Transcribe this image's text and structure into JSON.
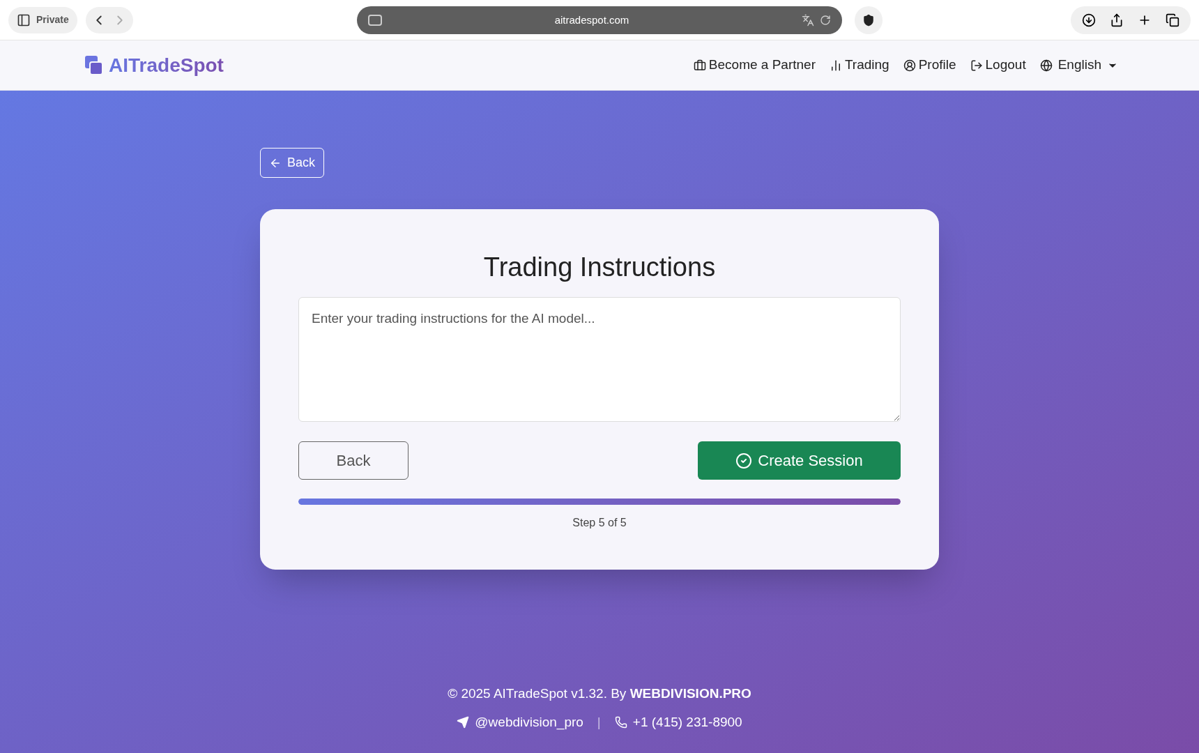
{
  "browser": {
    "private_label": "Private",
    "url": "aitradespot.com"
  },
  "nav": {
    "logo": "AITradeSpot",
    "links": [
      {
        "kind": "partner",
        "label": "Become a Partner"
      },
      {
        "kind": "trading",
        "label": "Trading"
      },
      {
        "kind": "profile",
        "label": "Profile"
      },
      {
        "kind": "logout",
        "label": "Logout"
      }
    ],
    "language": "English"
  },
  "back_link": "Back",
  "card": {
    "title": "Trading Instructions",
    "instructions": {
      "placeholder": "Enter your trading instructions for the AI model..."
    },
    "back_button": "Back",
    "create_button": "Create Session",
    "progress": {
      "level": 1
    },
    "step": "Step 5 of 5"
  },
  "footer": {
    "copyright": "© 2025 AITradeSpot v1.32. By **WEBDIVISION.PRO**",
    "telegram": "@webdivision_pro",
    "separator": "|",
    "phone": "+1 (415) 231-8900"
  }
}
